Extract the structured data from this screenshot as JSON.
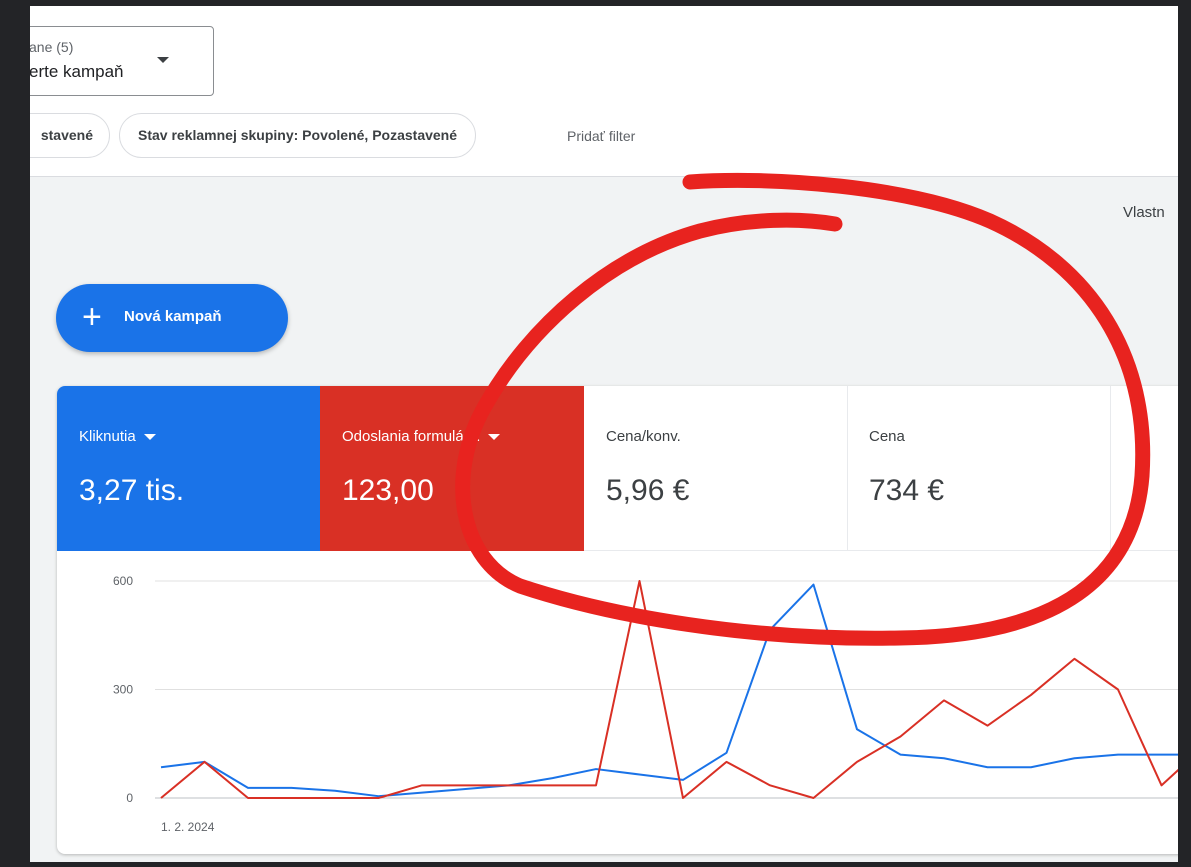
{
  "campaign_filter": {
    "label": "ane (5)",
    "value": "erte kampaň"
  },
  "filters": {
    "chips": [
      "stavené",
      "Stav reklamnej skupiny: Povolené, Pozastavené"
    ],
    "add_label": "Pridať filter"
  },
  "header": {
    "right_label": "Vlastn"
  },
  "new_campaign_label": "Nová kampaň",
  "metrics": [
    {
      "label": "Kliknutia",
      "value": "3,27 tis.",
      "color": "#1a73e8"
    },
    {
      "label": "Odoslania formulár...",
      "value": "123,00",
      "color": "#d93025"
    },
    {
      "label": "Cena/konv.",
      "value": "5,96 €"
    },
    {
      "label": "Cena",
      "value": "734 €"
    }
  ],
  "annotation": {
    "color": "#e8231f",
    "shape": "hand-drawn-circle"
  },
  "chart_data": {
    "type": "line",
    "y_ticks": [
      "600",
      "300",
      "0"
    ],
    "ylim": [
      0,
      600
    ],
    "x_tick_label": "1. 2. 2024",
    "series": [
      {
        "name": "Kliknutia",
        "color": "#1a73e8",
        "values": [
          85,
          100,
          28,
          28,
          20,
          5,
          15,
          25,
          35,
          55,
          80,
          65,
          50,
          125,
          465,
          590,
          190,
          120,
          110,
          85,
          85,
          110,
          120,
          120,
          120
        ]
      },
      {
        "name": "Odoslania formulár...",
        "color": "#d93025",
        "values": [
          0,
          100,
          0,
          0,
          0,
          0,
          35,
          35,
          35,
          35,
          35,
          600,
          0,
          100,
          35,
          0,
          100,
          170,
          270,
          200,
          285,
          385,
          300,
          35,
          145
        ]
      }
    ]
  }
}
